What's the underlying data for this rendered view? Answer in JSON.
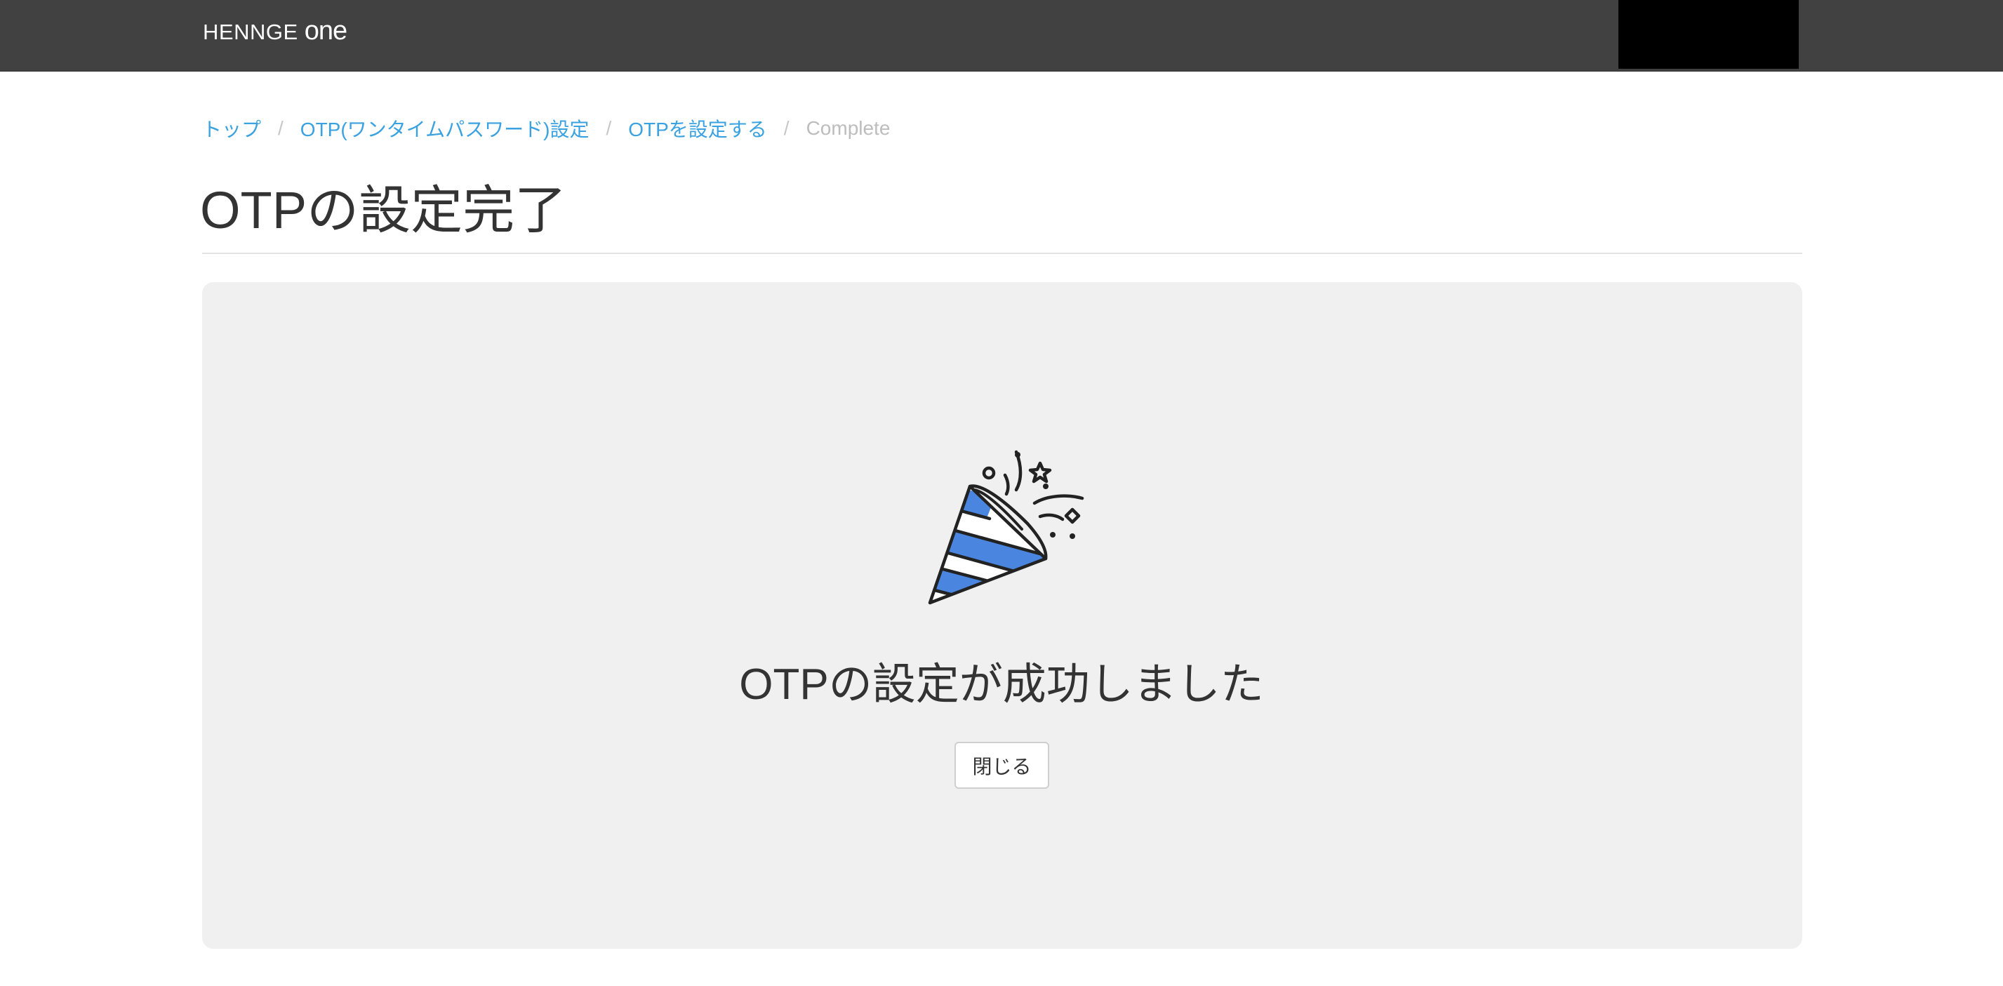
{
  "header": {
    "brand_main": "HENNGE ",
    "brand_suffix": "one",
    "colors": {
      "bar": "#414141",
      "brand_text": "#ffffff"
    }
  },
  "breadcrumb": {
    "items": [
      {
        "label": "トップ"
      },
      {
        "label": "OTP(ワンタイムパスワード)設定"
      },
      {
        "label": "OTPを設定する"
      }
    ],
    "current": "Complete",
    "separator": "/",
    "colors": {
      "link": "#3aa2e0",
      "current": "#bdbdbd"
    }
  },
  "page": {
    "title": "OTPの設定完了"
  },
  "result_panel": {
    "icon": "party-popper-icon",
    "message": "OTPの設定が成功しました",
    "close_label": "閉じる",
    "colors": {
      "panel_bg": "#f0f0f0",
      "stripe_blue": "#4a86e0"
    }
  }
}
